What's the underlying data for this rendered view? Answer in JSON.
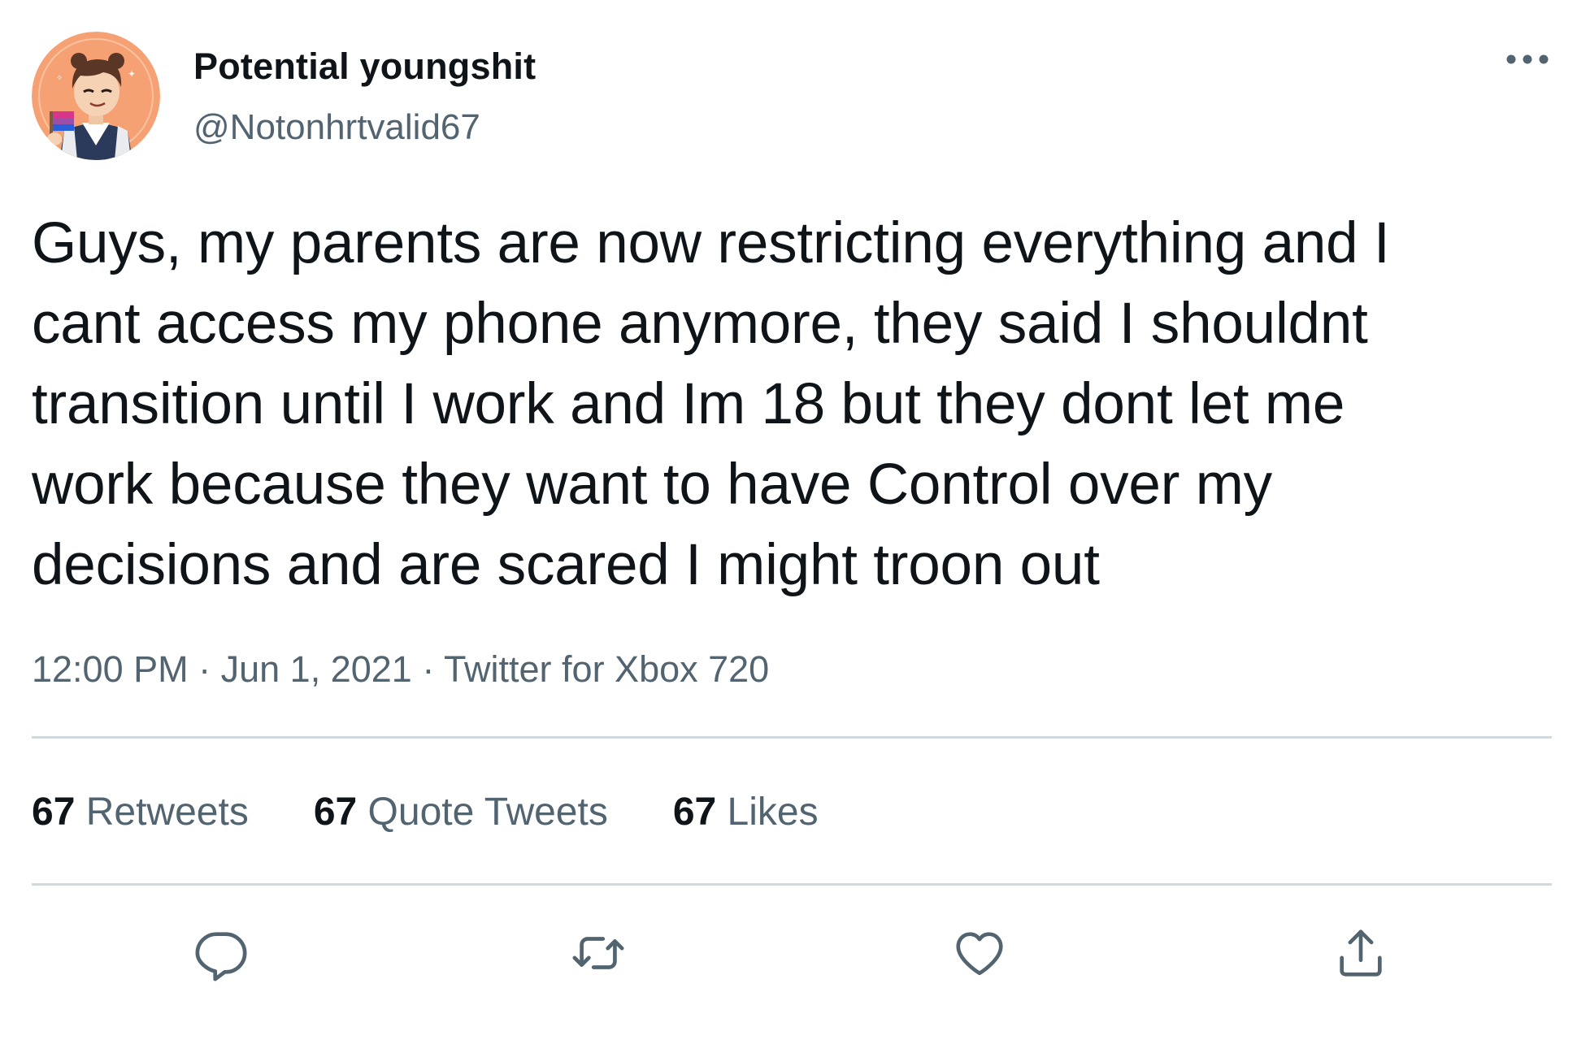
{
  "user": {
    "display_name": "Potential youngshit",
    "handle": "@Notonhrtvalid67"
  },
  "tweet": {
    "text": "Guys, my parents are now restricting everything and I\ncant access my phone anymore, they said I shouldnt\ntransition until I work and Im 18 but they dont let me\nwork because they want to have Control over my\ndecisions and are scared I might troon out",
    "time": "12:00 PM",
    "separator": " · ",
    "date": "Jun 1, 2021",
    "source": "Twitter for Xbox 720"
  },
  "stats": {
    "retweets_count": "67",
    "retweets_label": " Retweets",
    "quotes_count": "67",
    "quotes_label": " Quote Tweets",
    "likes_count": "67",
    "likes_label": " Likes"
  },
  "icons": {
    "more": "more-horizontal-icon",
    "reply": "reply-icon",
    "retweet": "retweet-icon",
    "like": "heart-icon",
    "share": "share-icon"
  },
  "colors": {
    "text_primary": "#0f1419",
    "text_secondary": "#536471",
    "divider": "#cfd9de",
    "avatar_bg": "#f6a173"
  }
}
